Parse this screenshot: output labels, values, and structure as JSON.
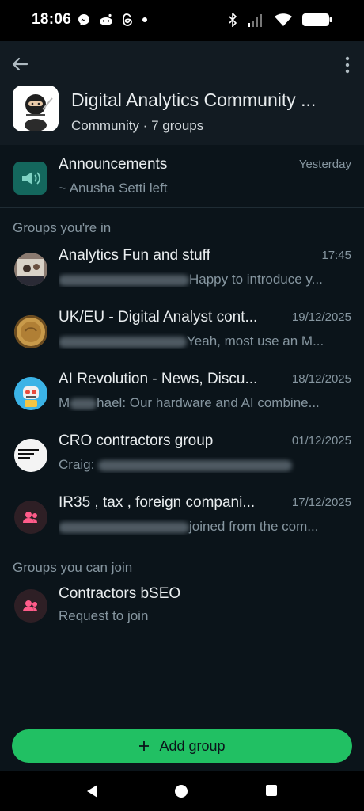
{
  "status": {
    "time": "18:06",
    "notifications": [
      "messenger-icon",
      "reddit-icon",
      "threads-icon",
      "dot-icon"
    ],
    "system": [
      "bluetooth-icon",
      "signal-icon",
      "wifi-icon",
      "battery-icon"
    ]
  },
  "header": {
    "title": "Digital Analytics Community ...",
    "subtitle": "Community · 7 groups"
  },
  "announcements": {
    "name": "Announcements",
    "time": "Yesterday",
    "message": "~ Anusha Setti left"
  },
  "sections": {
    "in": "Groups you're in",
    "can_join": "Groups you can join"
  },
  "groups": [
    {
      "name": "Analytics Fun and stuff",
      "time": "17:45",
      "prefix": "",
      "message": "Happy to introduce y..."
    },
    {
      "name": "UK/EU -  Digital Analyst cont...",
      "time": "19/12/2025",
      "prefix": "",
      "message": "Yeah, most use an M..."
    },
    {
      "name": "AI Revolution - News, Discu...",
      "time": "18/12/2025",
      "prefix": "M",
      "message": "hael: Our hardware and AI combine..."
    },
    {
      "name": "CRO contractors group",
      "time": "01/12/2025",
      "prefix": "Craig: ",
      "message": ""
    },
    {
      "name": "IR35 , tax , foreign compani...",
      "time": "17/12/2025",
      "prefix": "",
      "message": "joined from the com..."
    }
  ],
  "joinable": [
    {
      "name": "Contractors bSEO",
      "sub": "Request to join"
    }
  ],
  "add_group": "Add group",
  "colors": {
    "accent": "#21c063",
    "bg": "#0b141a",
    "header": "#121b22",
    "secondary_text": "#8696a0"
  }
}
